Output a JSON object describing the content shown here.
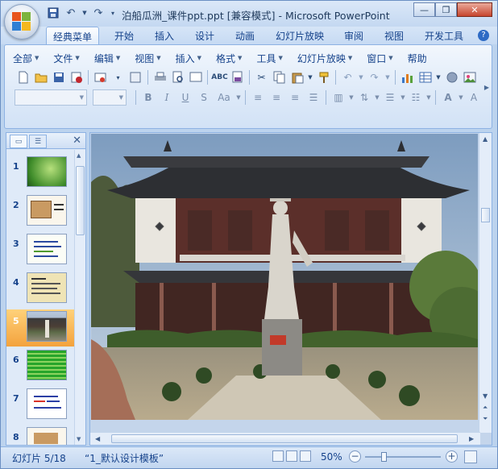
{
  "titlebar": {
    "title": "泊船瓜洲_课件ppt.ppt [兼容模式] - Microsoft PowerPoint",
    "quick_access": [
      "save-icon",
      "undo-icon",
      "redo-icon",
      "customize-icon"
    ],
    "controls": [
      "minimize-icon",
      "restore-icon",
      "close-icon"
    ]
  },
  "ribbon_tabs": [
    "经典菜单",
    "开始",
    "插入",
    "设计",
    "动画",
    "幻灯片放映",
    "审阅",
    "视图",
    "开发工具"
  ],
  "active_tab": "经典菜单",
  "menu_items": [
    "全部",
    "文件",
    "编辑",
    "视图",
    "插入",
    "格式",
    "工具",
    "幻灯片放映",
    "窗口",
    "帮助"
  ],
  "font_buttons": [
    "B",
    "I",
    "U",
    "S",
    "Aa"
  ],
  "left_panel": {
    "tabs": [
      "slides-tab",
      "outline-tab"
    ],
    "slides": [
      {
        "num": "1"
      },
      {
        "num": "2"
      },
      {
        "num": "3"
      },
      {
        "num": "4"
      },
      {
        "num": "5"
      },
      {
        "num": "6"
      },
      {
        "num": "7"
      },
      {
        "num": "8"
      }
    ],
    "selected": "5"
  },
  "status": {
    "slide_info": "幻灯片 5/18",
    "theme": "“1_默认设计模板”",
    "zoom": "50%"
  },
  "colors": {
    "ribbon_bg": "#dde9f8",
    "accent": "#15428b",
    "selected_thumb": "#f3a23d"
  }
}
